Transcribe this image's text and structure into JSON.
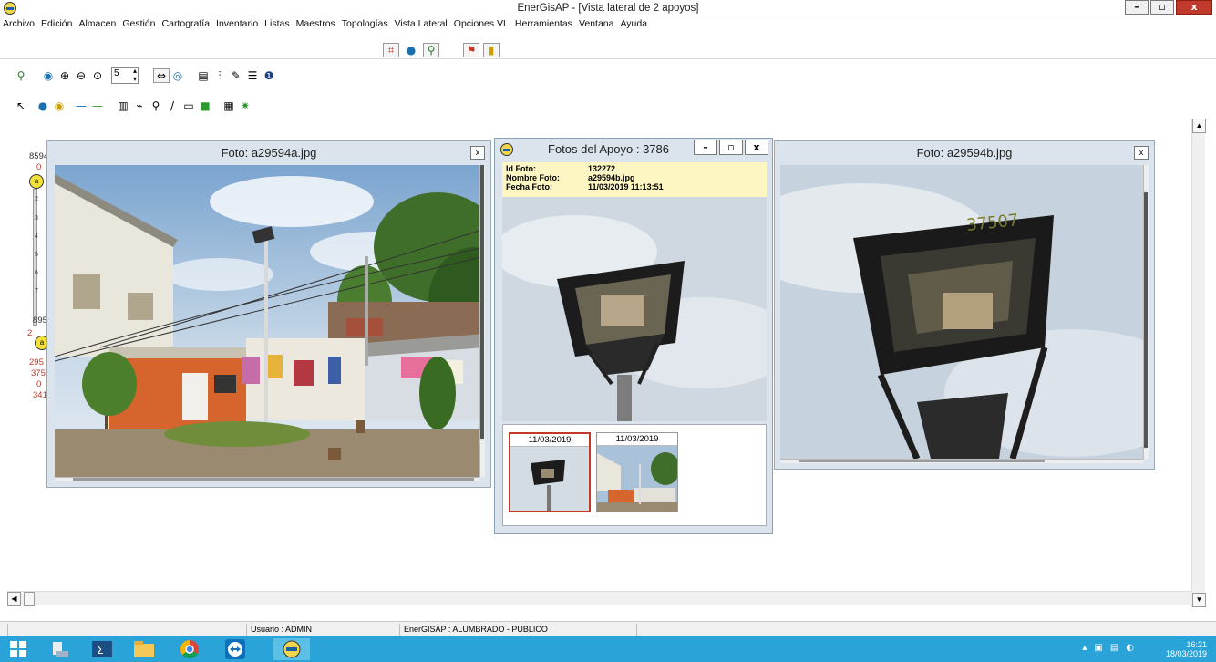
{
  "window": {
    "title": "EnerGisAP - [Vista lateral de 2 apoyos]",
    "minimize": "–",
    "maximize": "▫",
    "close": "x"
  },
  "menu": [
    "Archivo",
    "Edición",
    "Almacen",
    "Gestión",
    "Cartografía",
    "Inventario",
    "Listas",
    "Maestros",
    "Topologías",
    "Vista Lateral",
    "Opciones VL",
    "Herramientas",
    "Ventana",
    "Ayuda"
  ],
  "toolbar": {
    "zoom_step_value": "5"
  },
  "side_panel": {
    "top_value": "8594",
    "top_zero": "0",
    "node_label": "a",
    "scale": [
      "2",
      "3",
      "4",
      "5",
      "6",
      "7"
    ],
    "lower_value": "895",
    "red_values": [
      "2",
      "0",
      "295",
      "375",
      "0",
      "341"
    ]
  },
  "photo_left": {
    "title": "Foto: a29594a.jpg",
    "close": "x"
  },
  "photo_right": {
    "title": "Foto: a29594b.jpg",
    "close": "x"
  },
  "apoyo": {
    "title": "Fotos del Apoyo : 3786",
    "minimize": "–",
    "maximize": "▫",
    "close": "x",
    "labels": {
      "id": "Id Foto:",
      "nombre": "Nombre Foto:",
      "fecha": "Fecha Foto:"
    },
    "values": {
      "id": "132272",
      "nombre": "a29594b.jpg",
      "fecha": "11/03/2019 11:13:51"
    },
    "thumbnails": [
      {
        "date": "11/03/2019",
        "selected": true
      },
      {
        "date": "11/03/2019",
        "selected": false
      }
    ]
  },
  "statusbar": {
    "user": "Usuario : ADMIN",
    "module": "EnerGISAP : ALUMBRADO - PUBLICO"
  },
  "taskbar": {
    "time": "16:21",
    "date": "18/03/2019"
  },
  "colors": {
    "taskbar": "#2aa4d8",
    "window_frame": "#dbe4ec",
    "info_bg": "#fdf6c3",
    "selected_thumb": "#c0392b"
  }
}
